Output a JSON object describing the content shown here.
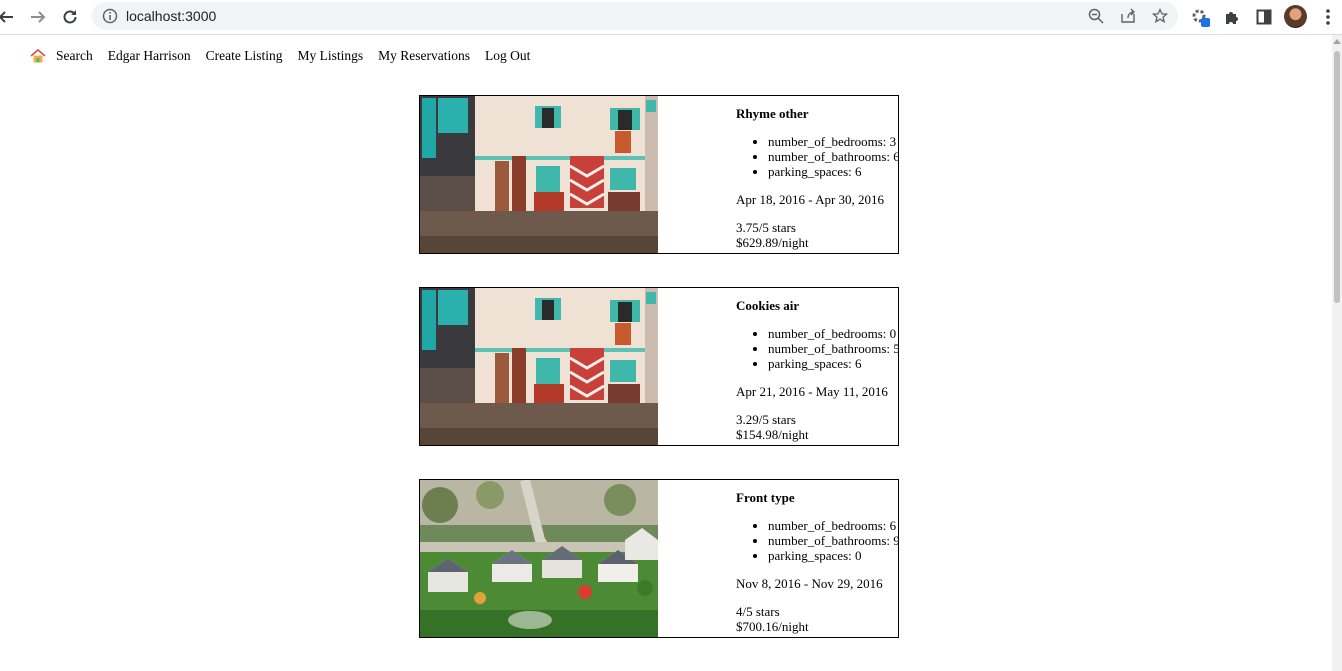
{
  "browser": {
    "url": "localhost:3000",
    "icons": [
      "back-icon",
      "forward-icon",
      "reload-icon",
      "info-icon",
      "zoom-icon",
      "share-icon",
      "bookmark-star-icon",
      "extension-gear-icon",
      "extensions-puzzle-icon",
      "side-panel-icon",
      "profile-avatar",
      "menu-kebab-icon"
    ]
  },
  "nav": {
    "home_icon": "house-icon",
    "items": [
      "Search",
      "Edgar Harrison",
      "Create Listing",
      "My Listings",
      "My Reservations",
      "Log Out"
    ]
  },
  "listings": [
    {
      "title": "Rhyme other",
      "features": [
        "number_of_bedrooms: 3",
        "number_of_bathrooms: 6",
        "parking_spaces: 6"
      ],
      "dates": "Apr 18, 2016 - Apr 30, 2016",
      "rating": "3.75/5 stars",
      "price": "$629.89/night",
      "image": "street-with-rugs"
    },
    {
      "title": "Cookies air",
      "features": [
        "number_of_bedrooms: 0",
        "number_of_bathrooms: 5",
        "parking_spaces: 6"
      ],
      "dates": "Apr 21, 2016 - May 11, 2016",
      "rating": "3.29/5 stars",
      "price": "$154.98/night",
      "image": "street-with-rugs"
    },
    {
      "title": "Front type",
      "features": [
        "number_of_bedrooms: 6",
        "number_of_bathrooms: 9",
        "parking_spaces: 0"
      ],
      "dates": "Nov 8, 2016 - Nov 29, 2016",
      "rating": "4/5 stars",
      "price": "$700.16/night",
      "image": "tilt-shift-neighborhood"
    }
  ]
}
